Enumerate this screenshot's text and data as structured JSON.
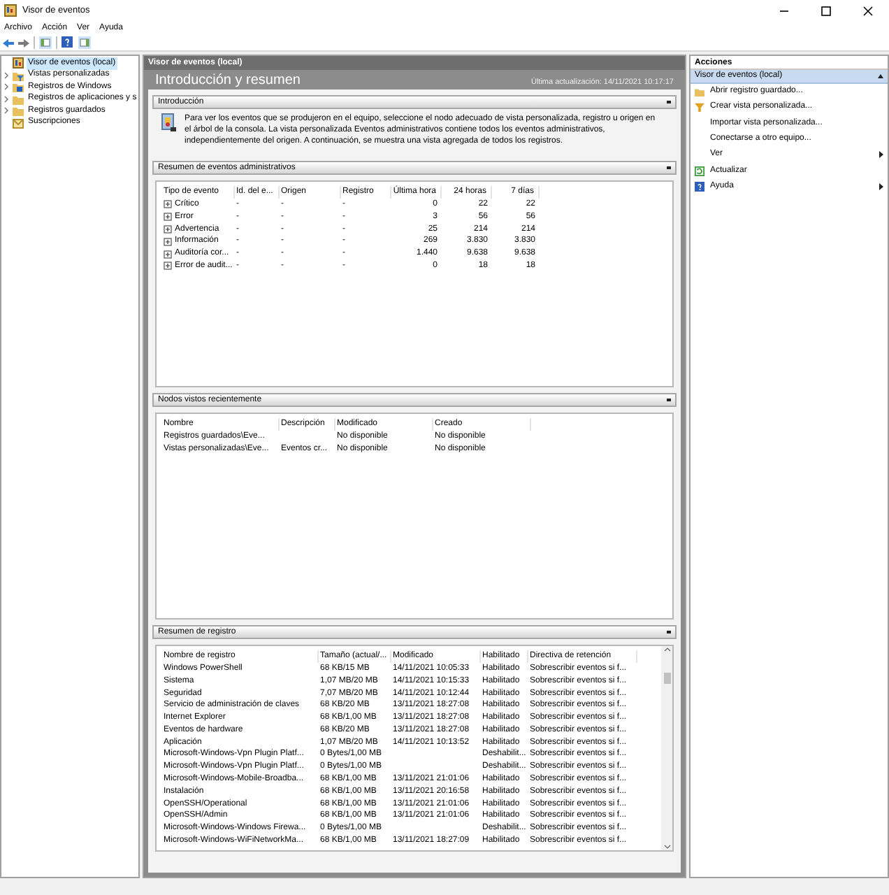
{
  "window": {
    "title": "Visor de eventos"
  },
  "menu": [
    "Archivo",
    "Acción",
    "Ver",
    "Ayuda"
  ],
  "tree": [
    {
      "label": "Visor de eventos (local)",
      "selected": true,
      "expandable": false,
      "kind": "viewer"
    },
    {
      "label": "Vistas personalizadas",
      "selected": false,
      "expandable": true,
      "kind": "filter-folder"
    },
    {
      "label": "Registros de Windows",
      "selected": false,
      "expandable": true,
      "kind": "windows-folder"
    },
    {
      "label": "Registros de aplicaciones y s",
      "selected": false,
      "expandable": true,
      "kind": "folder"
    },
    {
      "label": "Registros guardados",
      "selected": false,
      "expandable": true,
      "kind": "folder"
    },
    {
      "label": "Suscripciones",
      "selected": false,
      "expandable": false,
      "kind": "subs"
    }
  ],
  "center": {
    "header": "Visor de eventos (local)",
    "title": "Introducción y resumen",
    "last_update": "Última actualización: 14/11/2021 10:17:17",
    "intro": {
      "title": "Introducción",
      "text": "Para ver los eventos que se produjeron en el equipo, seleccione el nodo adecuado de vista personalizada, registro u origen en el árbol de la consola. La vista personalizada Eventos administrativos contiene todos los eventos administrativos, independientemente del origen. A continuación, se muestra una vista agregada de todos los registros."
    },
    "admin_summary": {
      "title": "Resumen de eventos administrativos",
      "columns": [
        "Tipo de evento",
        "Id. del e...",
        "Origen",
        "Registro",
        "Última hora",
        "24 horas",
        "7 días"
      ],
      "rows": [
        [
          "Crítico",
          "-",
          "-",
          "-",
          "0",
          "22",
          "22"
        ],
        [
          "Error",
          "-",
          "-",
          "-",
          "3",
          "56",
          "56"
        ],
        [
          "Advertencia",
          "-",
          "-",
          "-",
          "25",
          "214",
          "214"
        ],
        [
          "Información",
          "-",
          "-",
          "-",
          "269",
          "3.830",
          "3.830"
        ],
        [
          "Auditoría cor...",
          "-",
          "-",
          "-",
          "1.440",
          "9.638",
          "9.638"
        ],
        [
          "Error de audit...",
          "-",
          "-",
          "-",
          "0",
          "18",
          "18"
        ]
      ]
    },
    "recent_nodes": {
      "title": "Nodos vistos recientemente",
      "columns": [
        "Nombre",
        "Descripción",
        "Modificado",
        "Creado"
      ],
      "rows": [
        [
          "Registros guardados\\Eve...",
          "",
          "No disponible",
          "No disponible"
        ],
        [
          "Vistas personalizadas\\Eve...",
          "Eventos cr...",
          "No disponible",
          "No disponible"
        ]
      ]
    },
    "log_summary": {
      "title": "Resumen de registro",
      "columns": [
        "Nombre de registro",
        "Tamaño (actual/...",
        "Modificado",
        "Habilitado",
        "Directiva de retención"
      ],
      "rows": [
        [
          "Windows PowerShell",
          "68 KB/15 MB",
          "14/11/2021 10:05:33",
          "Habilitado",
          "Sobrescribir eventos si f..."
        ],
        [
          "Sistema",
          "1,07 MB/20 MB",
          "14/11/2021 10:15:33",
          "Habilitado",
          "Sobrescribir eventos si f..."
        ],
        [
          "Seguridad",
          "7,07 MB/20 MB",
          "14/11/2021 10:12:44",
          "Habilitado",
          "Sobrescribir eventos si f..."
        ],
        [
          "Servicio de administración de claves",
          "68 KB/20 MB",
          "13/11/2021 18:27:08",
          "Habilitado",
          "Sobrescribir eventos si f..."
        ],
        [
          "Internet Explorer",
          "68 KB/1,00 MB",
          "13/11/2021 18:27:08",
          "Habilitado",
          "Sobrescribir eventos si f..."
        ],
        [
          "Eventos de hardware",
          "68 KB/20 MB",
          "13/11/2021 18:27:08",
          "Habilitado",
          "Sobrescribir eventos si f..."
        ],
        [
          "Aplicación",
          "1,07 MB/20 MB",
          "14/11/2021 10:13:52",
          "Habilitado",
          "Sobrescribir eventos si f..."
        ],
        [
          "Microsoft-Windows-Vpn Plugin Platf...",
          "0 Bytes/1,00 MB",
          "",
          "Deshabilit...",
          "Sobrescribir eventos si f..."
        ],
        [
          "Microsoft-Windows-Vpn Plugin Platf...",
          "0 Bytes/1,00 MB",
          "",
          "Deshabilit...",
          "Sobrescribir eventos si f..."
        ],
        [
          "Microsoft-Windows-Mobile-Broadba...",
          "68 KB/1,00 MB",
          "13/11/2021 21:01:06",
          "Habilitado",
          "Sobrescribir eventos si f..."
        ],
        [
          "Instalación",
          "68 KB/1,00 MB",
          "13/11/2021 20:16:58",
          "Habilitado",
          "Sobrescribir eventos si f..."
        ],
        [
          "OpenSSH/Operational",
          "68 KB/1,00 MB",
          "13/11/2021 21:01:06",
          "Habilitado",
          "Sobrescribir eventos si f..."
        ],
        [
          "OpenSSH/Admin",
          "68 KB/1,00 MB",
          "13/11/2021 21:01:06",
          "Habilitado",
          "Sobrescribir eventos si f..."
        ],
        [
          "Microsoft-Windows-Windows Firewa...",
          "0 Bytes/1,00 MB",
          "",
          "Deshabilit...",
          "Sobrescribir eventos si f..."
        ],
        [
          "Microsoft-Windows-WiFiNetworkMa...",
          "68 KB/1,00 MB",
          "13/11/2021 18:27:09",
          "Habilitado",
          "Sobrescribir eventos si f..."
        ]
      ]
    }
  },
  "actions": {
    "title": "Acciones",
    "group": "Visor de eventos (local)",
    "items": [
      {
        "label": "Abrir registro guardado...",
        "kind": "folder",
        "submenu": false
      },
      {
        "label": "Crear vista personalizada...",
        "kind": "filter",
        "submenu": false
      },
      {
        "label": "Importar vista personalizada...",
        "kind": "plain",
        "submenu": false
      },
      {
        "label": "Conectarse a otro equipo...",
        "kind": "plain",
        "submenu": false
      },
      {
        "label": "Ver",
        "kind": "plain",
        "submenu": true
      },
      {
        "label": "Actualizar",
        "kind": "refresh",
        "submenu": false
      },
      {
        "label": "Ayuda",
        "kind": "help",
        "submenu": true
      }
    ]
  }
}
